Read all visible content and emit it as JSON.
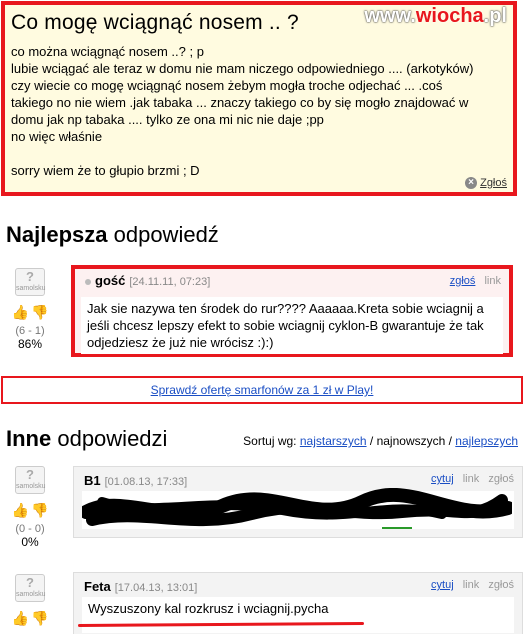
{
  "watermark": {
    "prefix": "www.",
    "brand": "wiocha",
    "suffix": ".pl"
  },
  "question": {
    "title": "Co mogę wciągnąć nosem .. ?",
    "lines": [
      "co można wciągnąć nosem ..? ; p",
      "lubie wciągać ale teraz w domu nie mam niczego odpowiedniego .... (arkotyków)",
      "czy wiecie co mogę wciągnąć nosem żebym mogła troche odjechać ... .coś",
      "takiego no nie wiem .jak tabaka ... znaczy takiego co by się mogło znajdować w",
      "domu jak np tabaka .... tylko ze ona mi nic nie daje ;pp",
      "no więc właśnie",
      "",
      "sorry wiem że to głupio brzmi ; D"
    ],
    "report_label": "Zgłoś"
  },
  "best_answer": {
    "heading_bold": "Najlepsza",
    "heading_rest": " odpowiedź",
    "badge": "samolsku",
    "votes": "(6 - 1)",
    "percent": "86%",
    "author": "gość",
    "date": "[24.11.11, 07:23]",
    "report": "zgłoś",
    "link": "link",
    "text": "Jak sie nazywa ten środek do rur???? Aaaaaa.Kreta sobie wciagnij a jeśli chcesz lepszy efekt to sobie wciagnij cyklon-B gwarantuje że tak odjedziesz że już nie wrócisz :):)"
  },
  "promo": {
    "text": "Sprawdź ofertę smarfonów za 1 zł w Play!"
  },
  "others": {
    "heading_bold": "Inne",
    "heading_rest": " odpowiedzi",
    "sort_label": "Sortuj wg:",
    "sort_oldest": "najstarszych",
    "sort_sep1": " / ",
    "sort_newest": "najnowszych",
    "sort_sep2": " / ",
    "sort_best": "najlepszych",
    "answers": [
      {
        "author": "B1",
        "date": "[01.08.13, 17:33]",
        "votes": "(0 - 0)",
        "percent": "0%",
        "quote": "cytuj",
        "link": "link",
        "report": "zgłoś",
        "text": ""
      },
      {
        "author": "Feta",
        "date": "[17.04.13, 13:01]",
        "votes": "",
        "percent": "",
        "quote": "cytuj",
        "link": "link",
        "report": "zgłoś",
        "text": "Wyszuszony kal rozkrusz i wciagnij.pycha"
      }
    ]
  },
  "colors": {
    "highlight": "#e8171d",
    "link": "#1a4ec4",
    "question_bg": "#fffbe0"
  }
}
